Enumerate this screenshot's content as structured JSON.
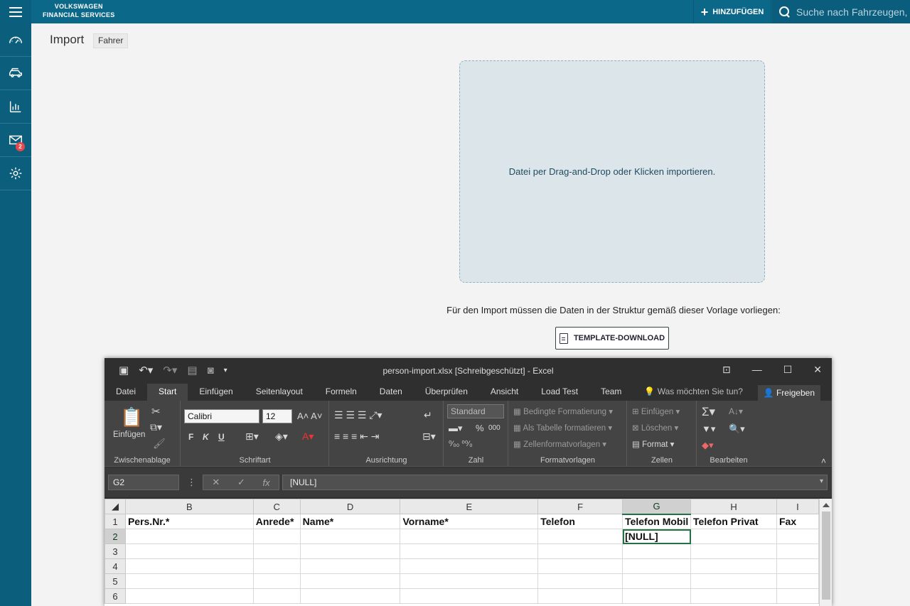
{
  "topbar": {
    "logo_line1": "VOLKSWAGEN",
    "logo_line2": "FINANCIAL SERVICES",
    "add_label": "HINZUFÜGEN",
    "search_placeholder": "Suche nach Fahrzeugen, V"
  },
  "sidebar": {
    "items": [
      {
        "icon": "speedometer-icon"
      },
      {
        "icon": "car-icon"
      },
      {
        "icon": "bar-chart-icon"
      },
      {
        "icon": "mail-icon",
        "badge": "2"
      },
      {
        "icon": "gear-icon"
      }
    ]
  },
  "main": {
    "title": "Import",
    "tag": "Fahrer",
    "dropzone_text": "Datei per Drag-and-Drop oder Klicken importieren.",
    "template_text": "Für den Import müssen die Daten in der Struktur gemäß dieser Vorlage vorliegen:",
    "template_button": "TEMPLATE-DOWNLOAD"
  },
  "excel": {
    "title": "person-import.xlsx [Schreibgeschützt] - Excel",
    "tabs": [
      "Datei",
      "Start",
      "Einfügen",
      "Seitenlayout",
      "Formeln",
      "Daten",
      "Überprüfen",
      "Ansicht",
      "Load Test",
      "Team"
    ],
    "tell_me": "Was möchten Sie tun?",
    "share": "Freigeben",
    "ribbon": {
      "clipboard_label": "Zwischenablage",
      "paste": "Einfügen",
      "font_label": "Schriftart",
      "font_name": "Calibri",
      "font_size": "12",
      "bold": "F",
      "italic": "K",
      "underline": "U",
      "align_label": "Ausrichtung",
      "number_label": "Zahl",
      "number_format": "Standard",
      "percent": "%",
      "thousands": "000",
      "styles_label": "Formatvorlagen",
      "cond_format": "Bedingte Formatierung",
      "as_table": "Als Tabelle formatieren",
      "cell_styles": "Zellenformatvorlagen",
      "cells_label": "Zellen",
      "insert": "Einfügen",
      "delete": "Löschen",
      "format": "Format",
      "edit_label": "Bearbeiten"
    },
    "name_box": "G2",
    "formula_value": "[NULL]",
    "columns": [
      "B",
      "C",
      "D",
      "E",
      "F",
      "G",
      "H",
      "I"
    ],
    "rows": [
      {
        "num": "1",
        "cells": [
          "Pers.Nr.*",
          "Anrede*",
          "Name*",
          "Vorname*",
          "Telefon",
          "Telefon Mobil",
          "Telefon Privat",
          "Fax"
        ]
      },
      {
        "num": "2",
        "cells": [
          "",
          "",
          "",
          "",
          "",
          "[NULL]",
          "",
          ""
        ]
      },
      {
        "num": "3",
        "cells": [
          "",
          "",
          "",
          "",
          "",
          "",
          "",
          ""
        ]
      },
      {
        "num": "4",
        "cells": [
          "",
          "",
          "",
          "",
          "",
          "",
          "",
          ""
        ]
      },
      {
        "num": "5",
        "cells": [
          "",
          "",
          "",
          "",
          "",
          "",
          "",
          ""
        ]
      },
      {
        "num": "6",
        "cells": [
          "",
          "",
          "",
          "",
          "",
          "",
          "",
          ""
        ]
      }
    ]
  }
}
